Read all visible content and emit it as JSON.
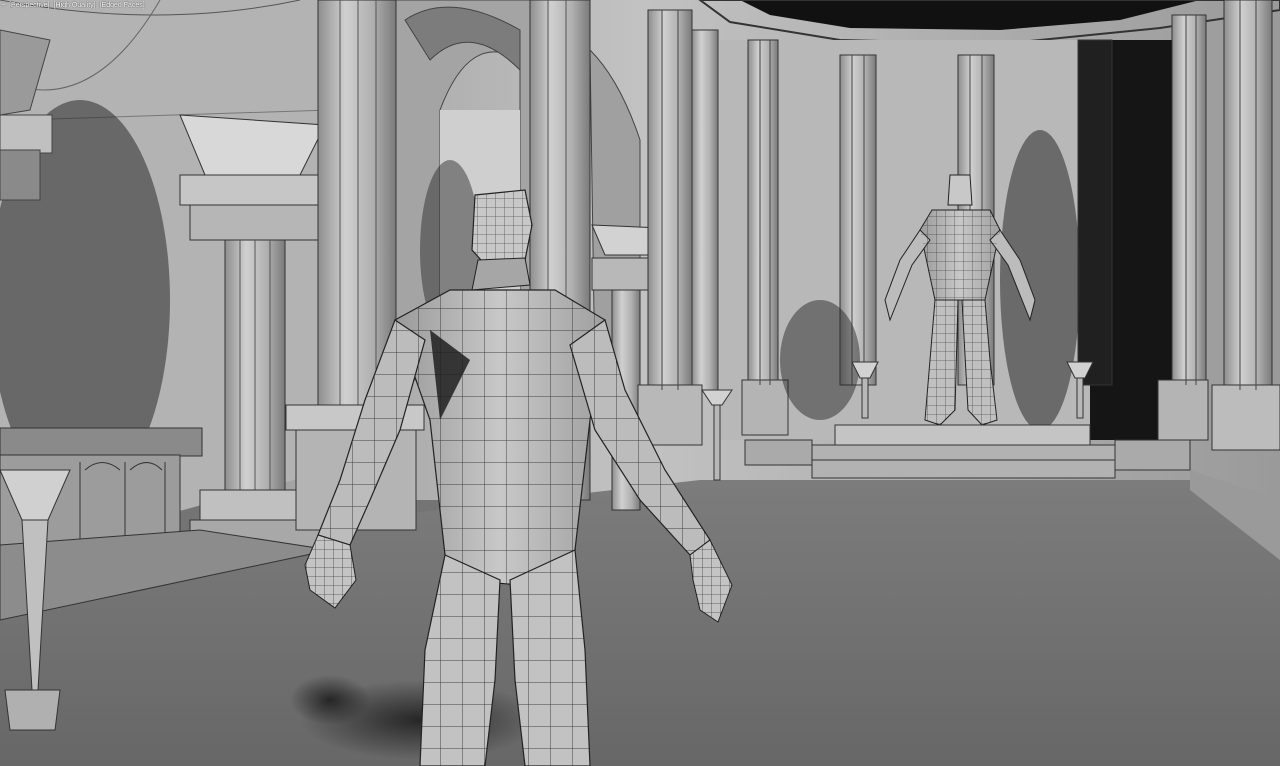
{
  "viewport": {
    "menu_plus": "+",
    "view_mode": "[Perspective]",
    "shading_mode": "[High Quality]",
    "edges_mode": "[Edged Faces]"
  },
  "scene": {
    "objects": [
      "character-foreground",
      "character-on-pedestal",
      "colonnade",
      "arches",
      "pedestal",
      "altar",
      "braziers"
    ],
    "colors": {
      "floor": "#6e6e6e",
      "wall": "#a8a8a8",
      "column": "#b4b4b4",
      "shadow": "#1c1c1c",
      "mesh": "#b9b9b9",
      "wire": "#202020"
    }
  }
}
